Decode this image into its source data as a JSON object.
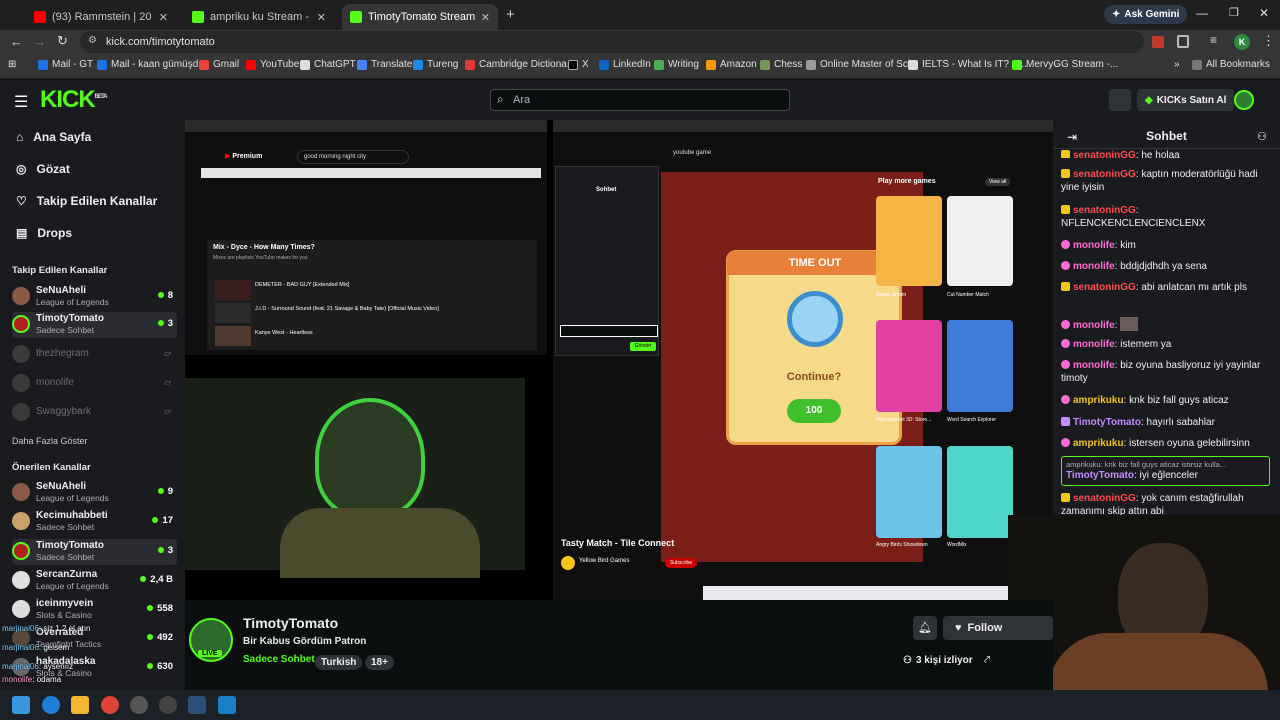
{
  "browser": {
    "tabs": [
      {
        "label": "(93) Rammstein | 20 Songs",
        "color": "#ff0000"
      },
      {
        "label": "ampriku ku Stream - Kick Dashb",
        "color": "#53fc18"
      },
      {
        "label": "TimotyTomato Stream - Wa",
        "color": "#53fc18"
      }
    ],
    "ask_gemini": "Ask Gemini",
    "url": "kick.com/timotytomato",
    "bookmarks": [
      "Mail - GT",
      "Mail - kaan gümüşd...",
      "Gmail",
      "YouTube",
      "ChatGPT",
      "Translate",
      "Tureng",
      "Cambridge Dictiona...",
      "X",
      "LinkedIn",
      "Writing",
      "Amazon",
      "Chess",
      "Online Master of Sci...",
      "IELTS - What Is IT? &...",
      "MervyGG Stream -..."
    ],
    "all_bookmarks": "All Bookmarks"
  },
  "kick": {
    "logo": "KICK",
    "logo_tag": "BETA",
    "search_placeholder": "Ara",
    "buy_label": "KICKs Satın Al",
    "nav": [
      {
        "label": "Ana Sayfa",
        "icon": "home-icon"
      },
      {
        "label": "Gözat",
        "icon": "compass-icon"
      },
      {
        "label": "Takip Edilen Kanallar",
        "icon": "heart-icon"
      },
      {
        "label": "Drops",
        "icon": "drops-icon"
      }
    ],
    "following_title": "Takip Edilen Kanallar",
    "following": [
      {
        "name": "SeNuAheli",
        "category": "League of Legends",
        "count": "8"
      },
      {
        "name": "TimotyTomato",
        "category": "Sadece Sohbet",
        "count": "3"
      },
      {
        "name": "thezhegram",
        "category": "",
        "count": ""
      },
      {
        "name": "monolife",
        "category": "",
        "count": ""
      },
      {
        "name": "Swaggybark",
        "category": "",
        "count": ""
      }
    ],
    "show_more": "Daha Fazla Göster",
    "recommended_title": "Önerilen Kanallar",
    "recommended": [
      {
        "name": "SeNuAheli",
        "category": "League of Legends",
        "count": "9"
      },
      {
        "name": "Kecimuhabbeti",
        "category": "Sadece Sohbet",
        "count": "17"
      },
      {
        "name": "TimotyTomato",
        "category": "Sadece Sohbet",
        "count": "3"
      },
      {
        "name": "SercanZurna",
        "category": "League of Legends",
        "count": "2,4 B"
      },
      {
        "name": "iceinmyvein",
        "category": "Slots & Casino",
        "count": "558"
      },
      {
        "name": "Overrated",
        "category": "Teamfight Tactics",
        "count": "492"
      },
      {
        "name": "hakadalaska",
        "category": "Slots & Casino",
        "count": "630"
      }
    ],
    "overlay_chat": [
      {
        "user": "marjinal06",
        "text": "siz 1 2 el atın"
      },
      {
        "user": "marjinal06",
        "text": "gelsem"
      },
      {
        "user": "marjinal06",
        "text": "aysenıız"
      },
      {
        "user": "monolife",
        "text": "odama"
      }
    ]
  },
  "stream": {
    "streamer": "TimotyTomato",
    "title": "Bir Kabus Gördüm Patron",
    "category": "Sadece Sohbet",
    "tags": [
      "Turkish",
      "18+"
    ],
    "viewers": "3 kişi izliyor",
    "follow_label": "Follow",
    "live_badge": "LIVE"
  },
  "inner": {
    "yt_search": "good morning night city",
    "yt_search2": "youtube game",
    "mix_title": "Mix - Dyce - How Many Times?",
    "mix_sub": "Mixes are playlists YouTube makes for you",
    "playlist": [
      "DEMETER - BAD GUY [Extended Mix]",
      "J.I.D - Surround Sound (feat. 21 Savage & Baby Tate) [Official Music Video]",
      "Kanye West - Heartless"
    ],
    "game_timeout": "TIME OUT",
    "game_continue": "Continue?",
    "game_cost": "100",
    "game_title": "Tasty Match - Tile Connect",
    "game_publisher": "Yellow Bird Games",
    "play_more": "Play more games",
    "view_all": "View all",
    "games": [
      {
        "name": "Snake Unjam",
        "color": "#f5b544"
      },
      {
        "name": "Cut Number Match",
        "color": "#f0f0f0"
      },
      {
        "name": "Hypermarket 3D: Store...",
        "color": "#e13fa2"
      },
      {
        "name": "Word Search Explorer",
        "color": "#3f7bd8"
      },
      {
        "name": "Angry Birds Showdown",
        "color": "#6ac3e8"
      },
      {
        "name": "WordMix",
        "color": "#4ed6c8"
      }
    ],
    "chat_title": "Sohbet",
    "send_label": "Gönder"
  },
  "chat": {
    "title": "Sohbet",
    "messages": [
      {
        "user": "senatoninGG",
        "text": "he holaa",
        "color": "#ff4d4d"
      },
      {
        "user": "senatoninGG",
        "text": "kaptın moderatörlüğü hadi yine iyisin",
        "color": "#ff4d4d"
      },
      {
        "user": "senatoninGG",
        "text": "NFLENCKENCLENCIENCLENX",
        "color": "#ff4d4d"
      },
      {
        "user": "monolife",
        "text": "kim",
        "color": "#ff6bd6"
      },
      {
        "user": "monolife",
        "text": "bddjdjdhdh ya sena",
        "color": "#ff6bd6"
      },
      {
        "user": "senatoninGG",
        "text": "abi anlatcan mı artık pls",
        "color": "#ff4d4d"
      },
      {
        "user": "monolife",
        "text": "",
        "color": "#ff6bd6"
      },
      {
        "user": "monolife",
        "text": "istemem ya",
        "color": "#ff6bd6"
      },
      {
        "user": "monolife",
        "text": "biz oyuna basliyoruz iyi yayinlar timoty",
        "color": "#ff6bd6"
      },
      {
        "user": "amprikuku",
        "text": "knk biz fall guys aticaz",
        "color": "#f5c518"
      },
      {
        "user": "TimotyTomato",
        "text": "hayırlı sabahlar",
        "color": "#c48bff"
      },
      {
        "user": "amprikuku",
        "text": "istersen oyuna gelebilirsinn",
        "color": "#f5c518"
      },
      {
        "user": "TimotyTomato",
        "text": "iyi eğlenceler",
        "color": "#c48bff"
      },
      {
        "user": "senatoninGG",
        "text": "yok canım estağfirullah zamanımı skip attın abi",
        "color": "#ff4d4d"
      }
    ],
    "reply_preview": "amprikuku: knk biz fall guys aticaz istirsiz kulla..."
  }
}
